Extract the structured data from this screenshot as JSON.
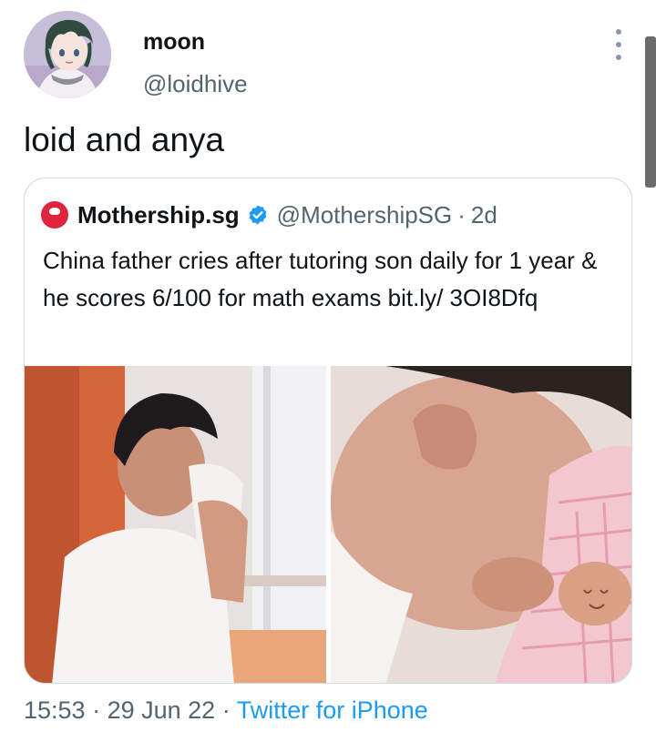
{
  "tweet": {
    "display_name": "moon",
    "handle": "@loidhive",
    "text": "loid and anya",
    "avatar_icon": "anime-avatar-image",
    "menu_icon": "more-vertical-icon"
  },
  "quoted_tweet": {
    "account_name": "Mothership.sg",
    "verified_icon": "verified-badge-icon",
    "handle": "@MothershipSG",
    "separator": "·",
    "age": "2d",
    "text": "China father cries after tutoring son daily for 1 year & he scores 6/100 for math exams bit.ly/ 3OI8Dfq",
    "media": [
      {
        "name": "photo-man-wiping-face"
      },
      {
        "name": "photo-man-crying-into-sleeve"
      }
    ]
  },
  "meta": {
    "time": "15:53",
    "dot1": " · ",
    "date": "29 Jun 22",
    "dot2": " · ",
    "source": "Twitter for iPhone"
  },
  "colors": {
    "text": "#0f1419",
    "secondary": "#536471",
    "link": "#1d9bf0",
    "border": "#cfd9de",
    "brand_red": "#e0243b"
  }
}
